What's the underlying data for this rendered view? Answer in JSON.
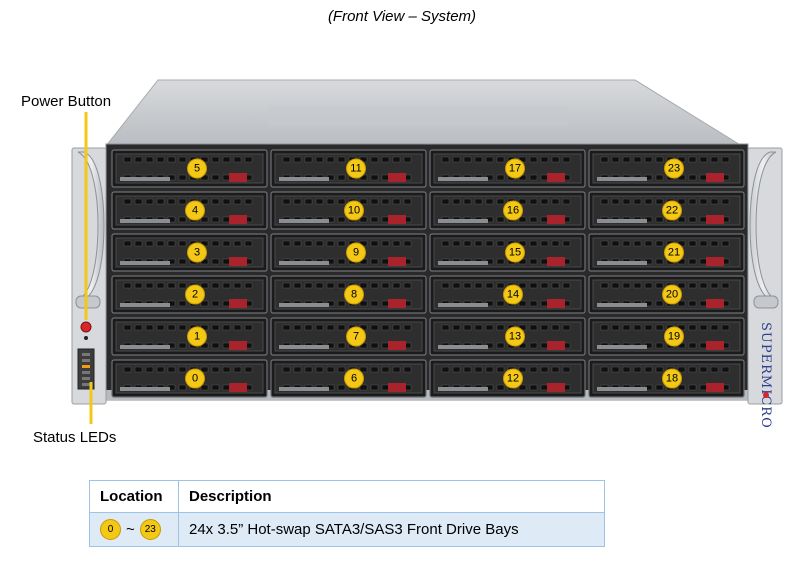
{
  "caption": "(Front View – System)",
  "callouts": {
    "power_button": "Power Button",
    "status_leds": "Status LEDs"
  },
  "brand": "SUPERMICRO",
  "bays": {
    "columns": [
      [
        "5",
        "4",
        "3",
        "2",
        "1",
        "0"
      ],
      [
        "11",
        "10",
        "9",
        "8",
        "7",
        "6"
      ],
      [
        "17",
        "16",
        "15",
        "14",
        "13",
        "12"
      ],
      [
        "23",
        "22",
        "21",
        "20",
        "19",
        "18"
      ]
    ]
  },
  "legend": {
    "headers": [
      "Location",
      "Description"
    ],
    "rows": [
      {
        "range_start": "0",
        "range_separator": "~",
        "range_end": "23",
        "description": "24x 3.5” Hot-swap  SATA3/SAS3 Front Drive Bays"
      }
    ]
  },
  "colors": {
    "badge": "#f3c816",
    "callout_line": "#f3c816",
    "power_led": "#d9262b",
    "table_border": "#9dc3e6",
    "table_row": "#deebf7"
  }
}
